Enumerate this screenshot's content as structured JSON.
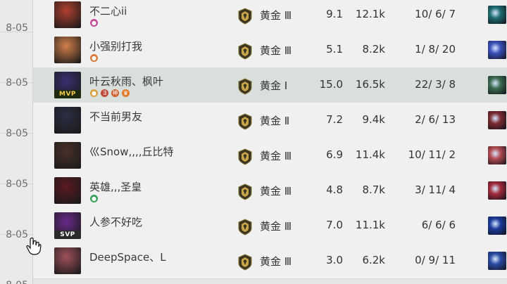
{
  "dates": [
    "8-05",
    "8-05",
    "8-05",
    "8-05",
    "8-05",
    "8-05"
  ],
  "rows": [
    {
      "name": "不二心ii",
      "tags": [
        {
          "icon": "pink-emblem-icon",
          "color": "#c54a9a",
          "text": "●"
        }
      ],
      "badge": "",
      "rank": "黄金 Ⅲ",
      "score": "9.1",
      "gold": "12.1k",
      "kda": "10/ 6/ 7",
      "avatar_color": "#b04030",
      "item_color": "#1d6b6e",
      "highlight": false
    },
    {
      "name": "小强别打我",
      "tags": [
        {
          "icon": "orange-emblem-icon",
          "color": "#d77a3a",
          "text": "●"
        }
      ],
      "badge": "",
      "rank": "黄金 Ⅲ",
      "score": "5.1",
      "gold": "8.2k",
      "kda": "1/ 8/ 20",
      "avatar_color": "#d2804a",
      "item_color": "#3a4fb8",
      "highlight": false
    },
    {
      "name": "叶云秋雨、枫叶",
      "tags": [
        {
          "icon": "coin-icon",
          "color": "#d9a23e",
          "text": "●"
        },
        {
          "icon": "rank-icon",
          "color": "#c04a3a",
          "text": "∃"
        },
        {
          "icon": "god-icon",
          "color": "#d05a2a",
          "text": "神"
        },
        {
          "icon": "crown-icon",
          "color": "#e07a2a",
          "text": "♛"
        }
      ],
      "badge": "MVP",
      "rank": "黄金 Ⅰ",
      "score": "15.0",
      "gold": "16.5k",
      "kda": "22/ 3/ 8",
      "avatar_color": "#3a3070",
      "item_color": "#3c6a50",
      "highlight": true
    },
    {
      "name": "不当前男友",
      "tags": [],
      "badge": "",
      "rank": "黄金 Ⅱ",
      "score": "7.2",
      "gold": "9.4k",
      "kda": "2/ 6/ 13",
      "avatar_color": "#2c2e44",
      "item_color": "#7a2a30",
      "highlight": false
    },
    {
      "name": "巛Snow,,,,丘比特",
      "tags": [],
      "badge": "",
      "rank": "黄金 Ⅲ",
      "score": "6.9",
      "gold": "11.4k",
      "kda": "10/ 11/ 2",
      "avatar_color": "#4a3028",
      "item_color": "#b04a50",
      "highlight": false
    },
    {
      "name": "英雄,,,圣皇",
      "tags": [
        {
          "icon": "shield-icon",
          "color": "#3aa05a",
          "text": "●"
        }
      ],
      "badge": "",
      "rank": "黄金 Ⅲ",
      "score": "4.8",
      "gold": "8.7k",
      "kda": "3/ 11/ 4",
      "avatar_color": "#5a1a20",
      "item_color": "#a02a3a",
      "highlight": false
    },
    {
      "name": "人参不好吃",
      "tags": [],
      "badge": "SVP",
      "rank": "黄金 Ⅲ",
      "score": "7.0",
      "gold": "11.1k",
      "kda": "6/ 6/ 6",
      "avatar_color": "#6a2a8a",
      "item_color": "#1a3a9a",
      "highlight": false
    },
    {
      "name": "DeepSpace、L",
      "tags": [],
      "badge": "",
      "rank": "黄金 Ⅲ",
      "score": "3.0",
      "gold": "6.2k",
      "kda": "0/ 9/ 11",
      "avatar_color": "#a0505a",
      "item_color": "#2a4aa0",
      "highlight": false
    }
  ]
}
